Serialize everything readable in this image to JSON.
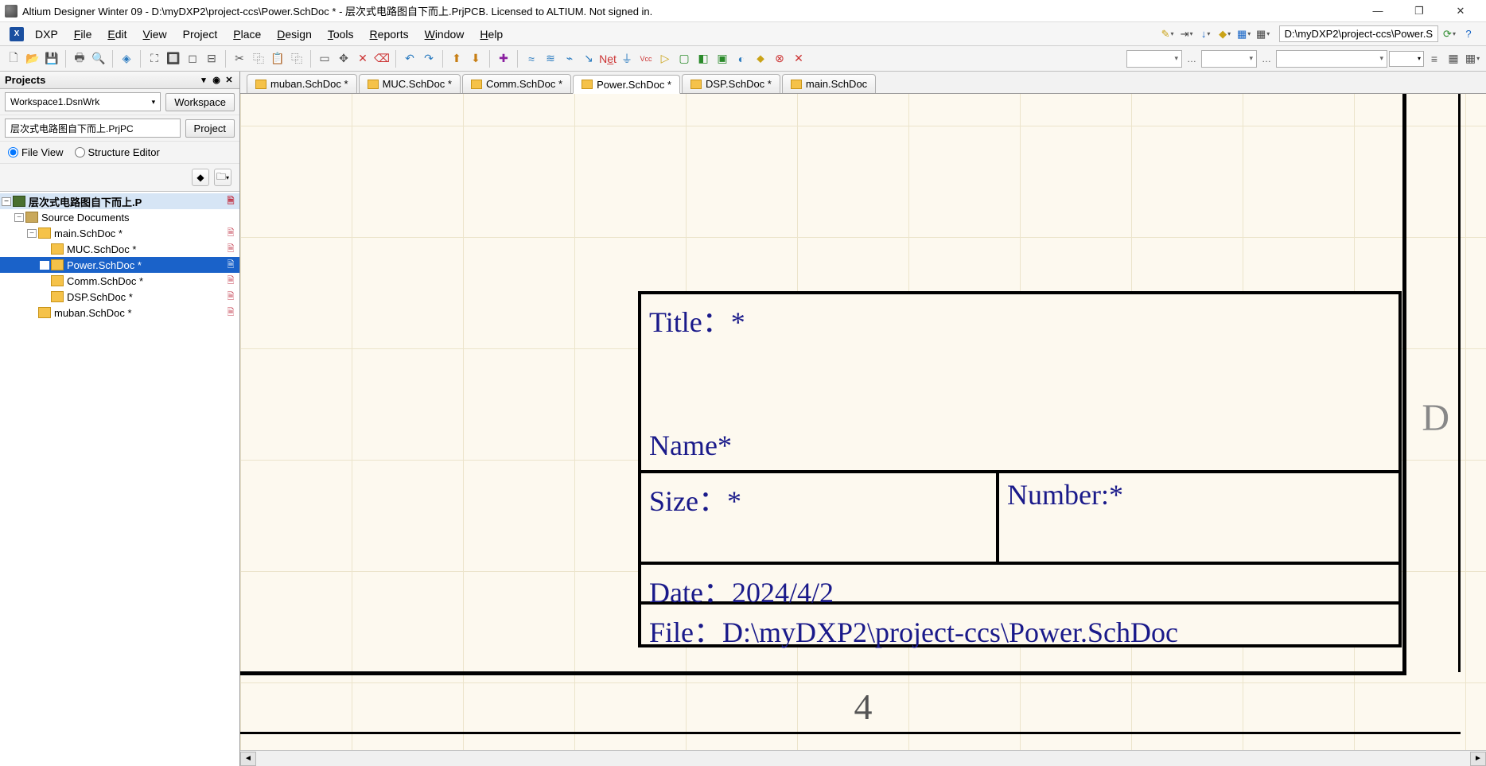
{
  "window": {
    "title": "Altium Designer Winter 09 - D:\\myDXP2\\project-ccs\\Power.SchDoc * - 层次式电路图自下而上.PrjPCB. Licensed to ALTIUM. Not signed in."
  },
  "menu": {
    "dxp": "DXP",
    "file": "File",
    "edit": "Edit",
    "view": "View",
    "project": "Project",
    "place": "Place",
    "design": "Design",
    "tools": "Tools",
    "reports": "Reports",
    "window": "Window",
    "help": "Help"
  },
  "address_bar": "D:\\myDXP2\\project-ccs\\Power.S",
  "projects_panel": {
    "title": "Projects",
    "workspace_combo": "Workspace1.DsnWrk",
    "workspace_btn": "Workspace",
    "project_combo": "层次式电路图自下而上.PrjPC",
    "project_btn": "Project",
    "file_view": "File View",
    "structure_editor": "Structure Editor"
  },
  "tree": {
    "project": "层次式电路图自下而上.P",
    "source_docs": "Source Documents",
    "main": "main.SchDoc *",
    "muc": "MUC.SchDoc *",
    "power": "Power.SchDoc *",
    "comm": "Comm.SchDoc *",
    "dsp": "DSP.SchDoc *",
    "muban": "muban.SchDoc *"
  },
  "tabs": {
    "muban": "muban.SchDoc *",
    "muc": "MUC.SchDoc *",
    "comm": "Comm.SchDoc *",
    "power": "Power.SchDoc *",
    "dsp": "DSP.SchDoc *",
    "main": "main.SchDoc"
  },
  "titleblock": {
    "title_label": "Title：*",
    "name_label": "Name*",
    "size_label": "Size：*",
    "number_label": "Number:*",
    "date_label": "Date：",
    "date_value": "2024/4/2",
    "file_label": "File：",
    "file_value": "D:\\myDXP2\\project-ccs\\Power.SchDoc"
  },
  "canvas": {
    "zone_letter": "D",
    "page_number": "4"
  }
}
